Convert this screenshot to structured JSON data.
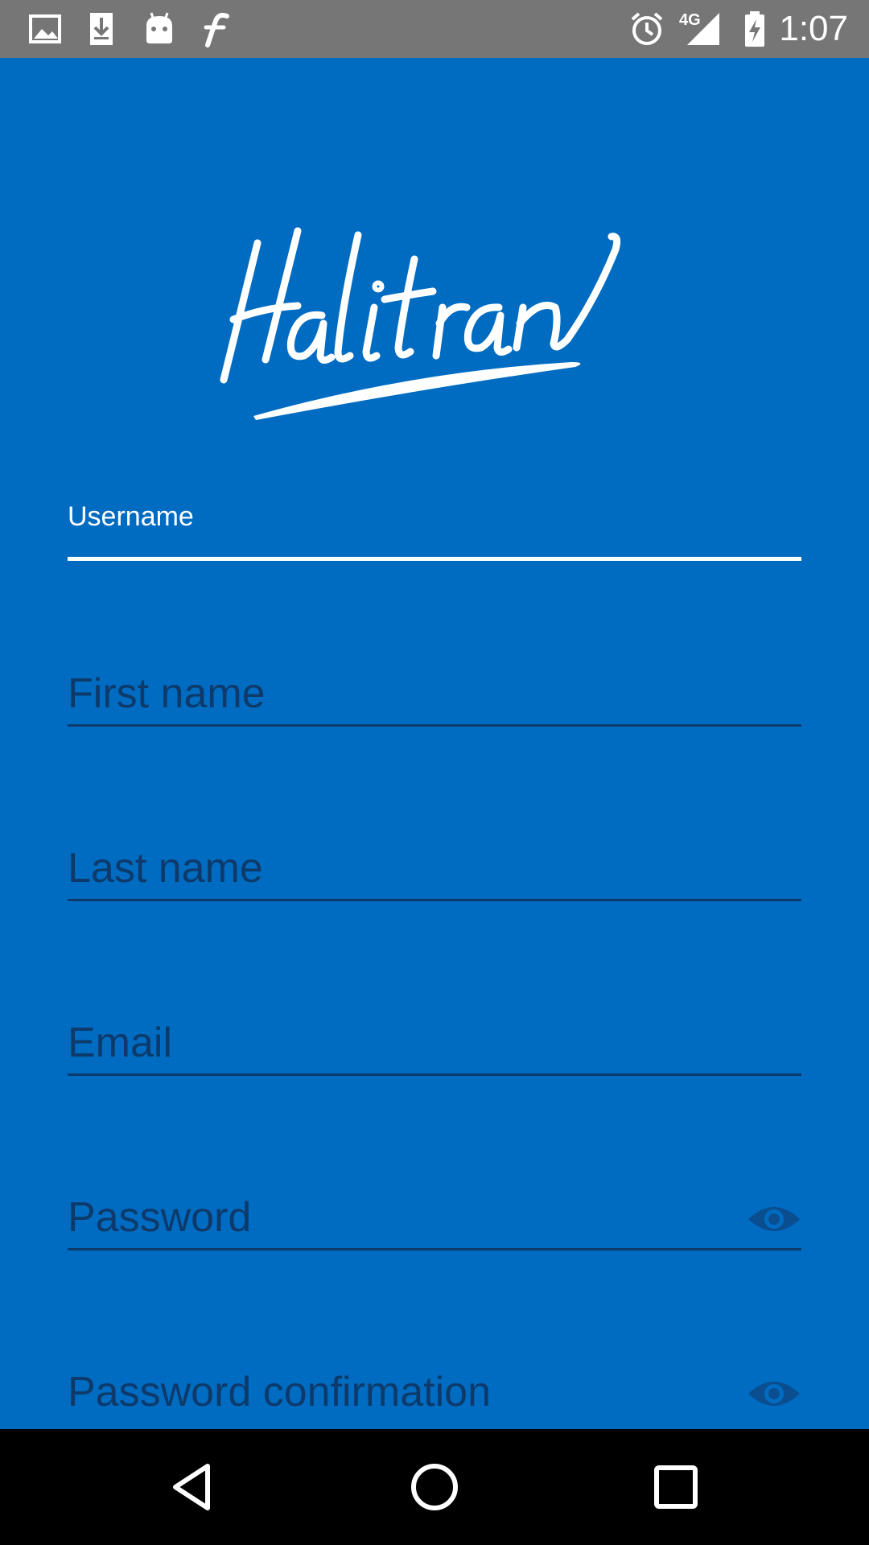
{
  "status_bar": {
    "time": "1:07",
    "network": "4G",
    "left_icons": [
      "image-icon",
      "download-icon",
      "android-icon",
      "f-app-icon"
    ],
    "right_icons": [
      "alarm-icon",
      "signal-icon",
      "battery-charging-icon"
    ]
  },
  "app": {
    "background_color": "#006cc1",
    "logo_text": "Halitran"
  },
  "form": {
    "username": {
      "label": "Username",
      "value": ""
    },
    "first_name": {
      "placeholder": "First name"
    },
    "last_name": {
      "placeholder": "Last name"
    },
    "email": {
      "placeholder": "Email"
    },
    "password": {
      "placeholder": "Password",
      "toggle_icon": "eye-icon"
    },
    "password_confirmation": {
      "placeholder": "Password confirmation",
      "toggle_icon": "eye-icon"
    }
  },
  "nav_bar": {
    "buttons": [
      "back-icon",
      "home-icon",
      "recents-icon"
    ]
  }
}
